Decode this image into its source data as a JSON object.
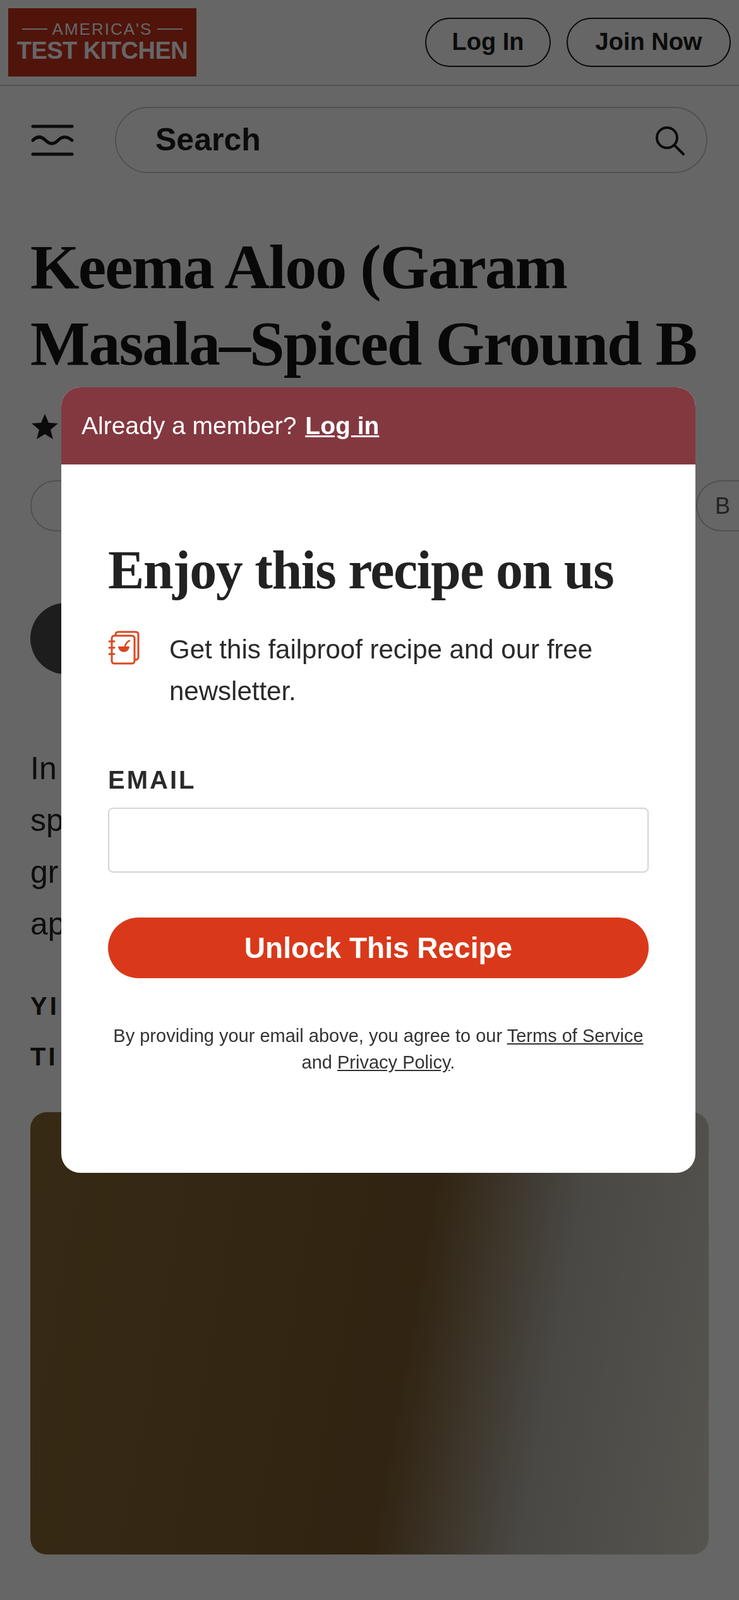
{
  "header": {
    "logo": {
      "top": "AMERICA'S",
      "bottom": "TEST KITCHEN"
    },
    "buttons": [
      "Log In",
      "Join Now"
    ]
  },
  "search": {
    "placeholder": "Search"
  },
  "recipe": {
    "title": "Keema Aloo (Garam Masala–Spiced Ground B",
    "rating": {
      "stars": 1
    },
    "action_pill": "B",
    "intro_fragments": [
      "In",
      "sp",
      "gr",
      "ap"
    ],
    "meta_fragments": [
      "YI",
      "TI"
    ]
  },
  "modal": {
    "member_prompt": "Already a member?",
    "login_link": "Log in",
    "heading": "Enjoy this recipe on us",
    "feature": "Get this failproof recipe and our free newsletter.",
    "email_label": "EMAIL",
    "submit": "Unlock This Recipe",
    "legal": {
      "prefix": "By providing your email above, you agree to our ",
      "terms": "Terms of Service",
      "and": " and ",
      "privacy": "Privacy Policy",
      "end": "."
    }
  }
}
